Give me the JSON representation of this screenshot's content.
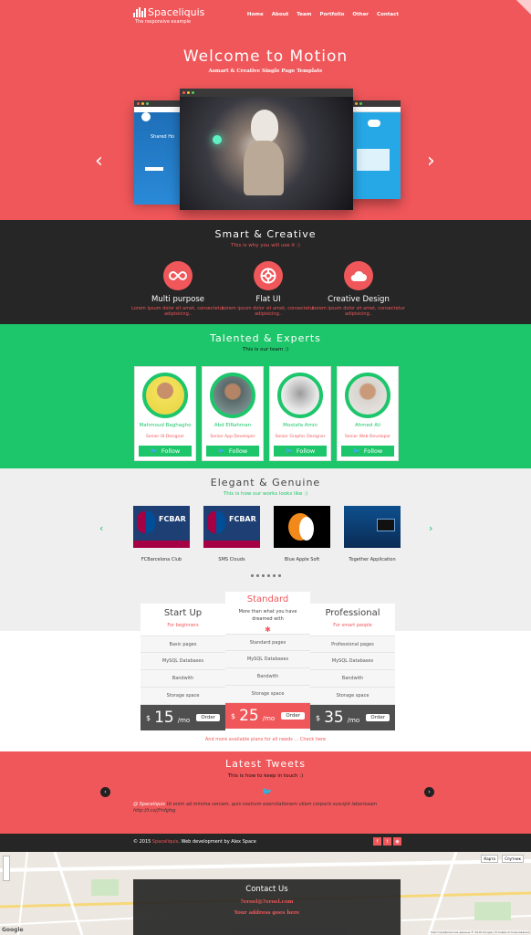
{
  "header": {
    "logo_text": "Spaceliquis",
    "tagline": "The responsive example",
    "nav": [
      "Home",
      "About",
      "Team",
      "Portfolio",
      "Other",
      "Contact"
    ]
  },
  "hero": {
    "title": "Welcome to Motion",
    "subtitle": "Asmart & Creative Single Page Template",
    "left_arrow": "‹",
    "right_arrow": "›",
    "left_screen_text": "Shared Ho"
  },
  "features": {
    "title": "Smart & Creative",
    "subtitle": "This is why you will use it :)",
    "items": [
      {
        "icon": "infinity-icon",
        "title": "Multi purpose",
        "desc": "Lorem ipsum dolor sit amet, consectetur adipisicing.."
      },
      {
        "icon": "lifebuoy-icon",
        "title": "Flat UI",
        "desc": "Lorem ipsum dolor sit amet, consectetur adipisicing.."
      },
      {
        "icon": "cloud-icon",
        "title": "Creative Design",
        "desc": "Lorem ipsum dolor sit amet, consectetur adipisicing.."
      }
    ]
  },
  "team": {
    "title": "Talented & Experts",
    "subtitle": "This is our team :)",
    "follow_label": "Follow",
    "members": [
      {
        "name": "Mahmoud Baghagho",
        "role": "Senior UI Designer"
      },
      {
        "name": "Abd ElRahman",
        "role": "Senior App Developer"
      },
      {
        "name": "Mostafa Amin",
        "role": "Senior Graphic Designer"
      },
      {
        "name": "Ahmed Ali",
        "role": "Senior Web Developer"
      }
    ]
  },
  "works": {
    "title": "Elegant & Genuine",
    "subtitle": "This is how our works looks like :)",
    "items": [
      {
        "label": "FCBarcelona Club",
        "thumb_text": "FCBAR"
      },
      {
        "label": "SMS Clouds",
        "thumb_text": "FCBAR"
      },
      {
        "label": "Blue Apple Soft",
        "thumb_text": ""
      },
      {
        "label": "Together Application",
        "thumb_text": ""
      }
    ],
    "dot_count": 6
  },
  "pricing": {
    "currency": "$",
    "order_label": "Order",
    "per": "/mo",
    "plans": [
      {
        "title": "Start Up",
        "for": "For beginners",
        "features": [
          "Basic pages",
          "MySQL Databases",
          "Bandwith",
          "Storage space"
        ],
        "price": "15"
      },
      {
        "title": "Standard",
        "for": "More than what you have dreamed with",
        "features": [
          "Standard pages",
          "MySQL Databases",
          "Bandwith",
          "Storage space"
        ],
        "price": "25"
      },
      {
        "title": "Professional",
        "for": "For smart people",
        "features": [
          "Professional pages",
          "MySQL Databases",
          "Bandwith",
          "Storage space"
        ],
        "price": "35"
      }
    ],
    "more_link": "And more available plans for all needs ... Check here"
  },
  "tweets": {
    "title": "Latest Tweets",
    "subtitle": "This is how to keep in touch :)",
    "handle": "@ Spaceliquis",
    "text": " Ut enim ad minima veniam, quis nostrum exercitationem ullam corporis suscipit laboriosam",
    "link": "http://t.co/jYnfgfsg"
  },
  "footer": {
    "copyright": "© 2015",
    "brand": "Spaceliquis",
    "credit": ". Web development by Alex Space"
  },
  "contact": {
    "title": "Contact Us",
    "email": "?eroel@?eroel.com",
    "address": "Your address goes here"
  },
  "map": {
    "google_label": "Google",
    "map_type_1": "Карта",
    "map_type_2": "Спутник",
    "attribution": "Картографические данные © 2016 Google | Условия использования"
  },
  "colors": {
    "accent": "#f0575a",
    "green": "#1ec66b",
    "dark": "#262626",
    "light": "#efefef"
  }
}
